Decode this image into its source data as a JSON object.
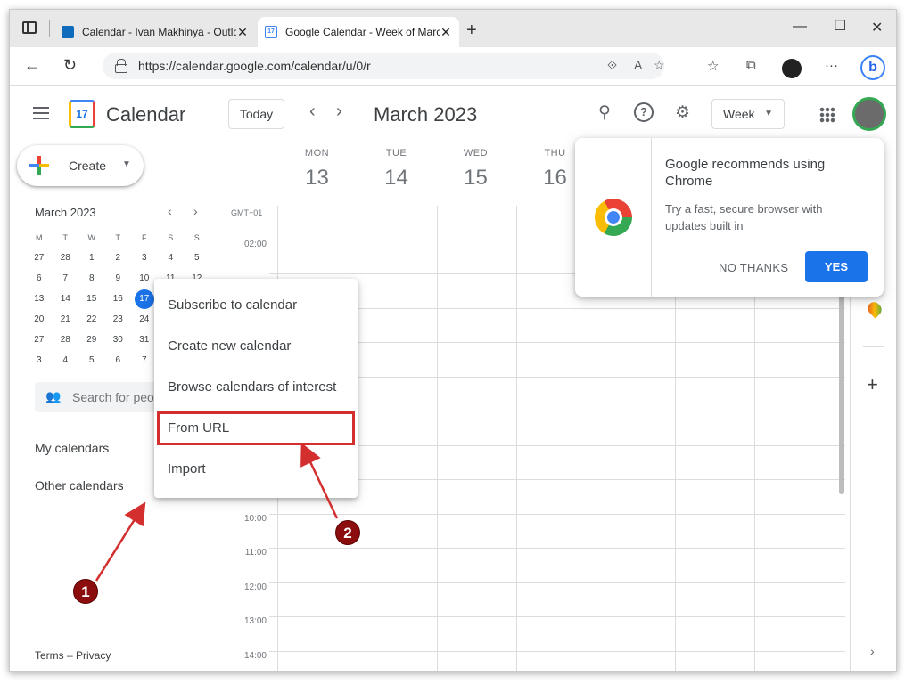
{
  "browser": {
    "tabs": [
      {
        "title": "Calendar - Ivan Makhinya - Outlo",
        "active": false
      },
      {
        "title": "Google Calendar - Week of Marc",
        "active": true
      }
    ],
    "url": "https://calendar.google.com/calendar/u/0/r",
    "icons": [
      "tab-actions-icon",
      "back-icon",
      "reload-icon",
      "lock-icon",
      "favorites-icon",
      "collections-icon",
      "more-icon",
      "bing-icon"
    ]
  },
  "header": {
    "app_name": "Calendar",
    "logo_day": "17",
    "today_label": "Today",
    "month_title": "March 2023",
    "view_label": "Week"
  },
  "sidebar": {
    "create_label": "Create",
    "mini_month": "March 2023",
    "mini_dow": [
      "M",
      "T",
      "W",
      "T",
      "F",
      "S",
      "S"
    ],
    "mini_weeks": [
      [
        "27",
        "28",
        "1",
        "2",
        "3",
        "4",
        "5"
      ],
      [
        "6",
        "7",
        "8",
        "9",
        "10",
        "11",
        "12"
      ],
      [
        "13",
        "14",
        "15",
        "16",
        "17",
        "",
        ""
      ],
      [
        "20",
        "21",
        "22",
        "23",
        "24",
        "",
        ""
      ],
      [
        "27",
        "28",
        "29",
        "30",
        "31",
        "",
        ""
      ],
      [
        "3",
        "4",
        "5",
        "6",
        "7",
        "",
        ""
      ]
    ],
    "selected_day": "17",
    "search_placeholder": "Search for peop",
    "my_calendars": "My calendars",
    "other_calendars": "Other calendars",
    "footer": "Terms – Privacy"
  },
  "week": {
    "timezone": "GMT+01",
    "days": [
      {
        "dow": "MON",
        "num": "13"
      },
      {
        "dow": "TUE",
        "num": "14"
      },
      {
        "dow": "WED",
        "num": "15"
      },
      {
        "dow": "THU",
        "num": "16"
      }
    ],
    "hours": [
      {
        "label": "02:00",
        "visible": true
      },
      {
        "label": "10:00",
        "visible": true
      },
      {
        "label": "11:00",
        "visible": true
      },
      {
        "label": "12:00",
        "visible": true
      },
      {
        "label": "13:00",
        "visible": true
      },
      {
        "label": "14:00",
        "visible": true
      }
    ]
  },
  "chrome_promo": {
    "title": "Google recommends using Chrome",
    "body": "Try a fast, secure browser with updates built in",
    "no_label": "NO THANKS",
    "yes_label": "YES"
  },
  "context_menu": {
    "items": [
      "Subscribe to calendar",
      "Create new calendar",
      "Browse calendars of interest",
      "From URL",
      "Import"
    ],
    "highlighted": "From URL"
  },
  "annotations": {
    "badge1": "1",
    "badge2": "2",
    "color": "#d32f2f"
  }
}
